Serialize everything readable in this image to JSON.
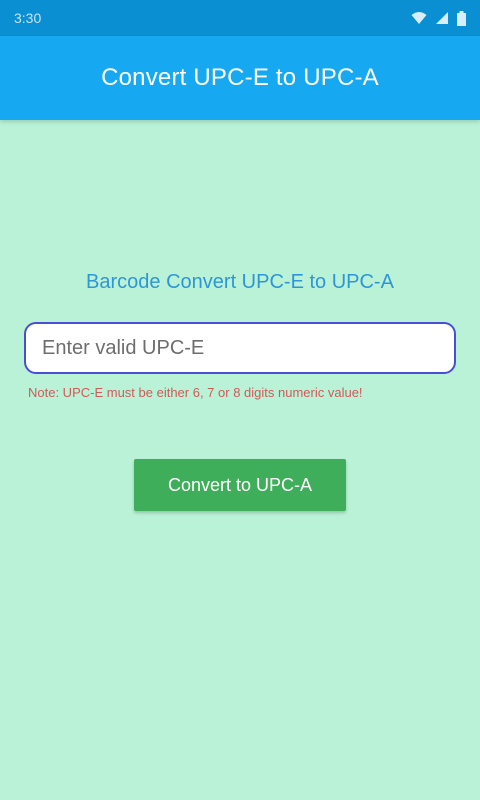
{
  "status_bar": {
    "time": "3:30",
    "icons": [
      "wifi-icon",
      "signal-icon",
      "battery-icon"
    ]
  },
  "app_bar": {
    "title": "Convert UPC-E to UPC-A"
  },
  "main": {
    "heading": "Barcode Convert UPC-E to UPC-A",
    "input": {
      "value": "",
      "placeholder": "Enter valid UPC-E"
    },
    "note": "Note: UPC-E must be either 6, 7 or 8 digits numeric value!",
    "button_label": "Convert to UPC-A"
  },
  "colors": {
    "background": "#b9f2d6",
    "status_bar": "#0b8fd3",
    "app_bar": "#16a9f2",
    "heading": "#2f96d6",
    "input_border": "#4a4ed6",
    "note": "#d05a5a",
    "button": "#3fae5a"
  }
}
